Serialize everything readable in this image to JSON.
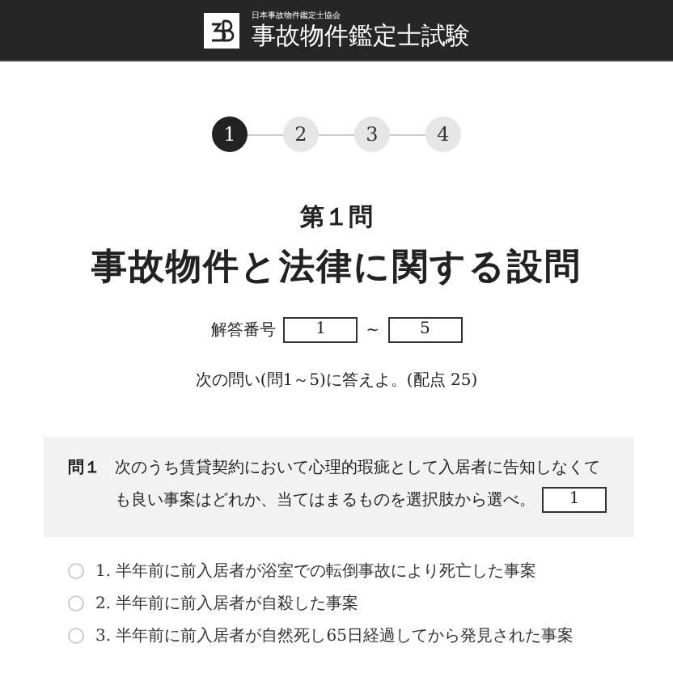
{
  "header": {
    "organization": "日本事故物件鑑定士協会",
    "title": "事故物件鑑定士試験"
  },
  "steps": [
    {
      "label": "1",
      "selected": true
    },
    {
      "label": "2",
      "selected": false
    },
    {
      "label": "3",
      "selected": false
    },
    {
      "label": "4",
      "selected": false
    }
  ],
  "section": {
    "number": "第１問",
    "title": "事故物件と法律に関する設問"
  },
  "answer_range": {
    "label": "解答番号",
    "from": "1",
    "separator": "~",
    "to": "5"
  },
  "instruction": "次の問い(問1～5)に答えよ。(配点 25)",
  "question": {
    "number": "問１",
    "text_lines": [
      "次のうち賃貸契約において心理的瑕疵として入居者に告知しなくて",
      "も良い事案はどれか、当てはまるものを選択肢から選べ。"
    ],
    "answer": "1"
  },
  "options": [
    {
      "label": "1. 半年前に前入居者が浴室での転倒事故により死亡した事案",
      "selected": false
    },
    {
      "label": "2. 半年前に前入居者が自殺した事案",
      "selected": false
    },
    {
      "label": "3. 半年前に前入居者が自然死し65日経過してから発見された事案",
      "selected": false
    }
  ]
}
